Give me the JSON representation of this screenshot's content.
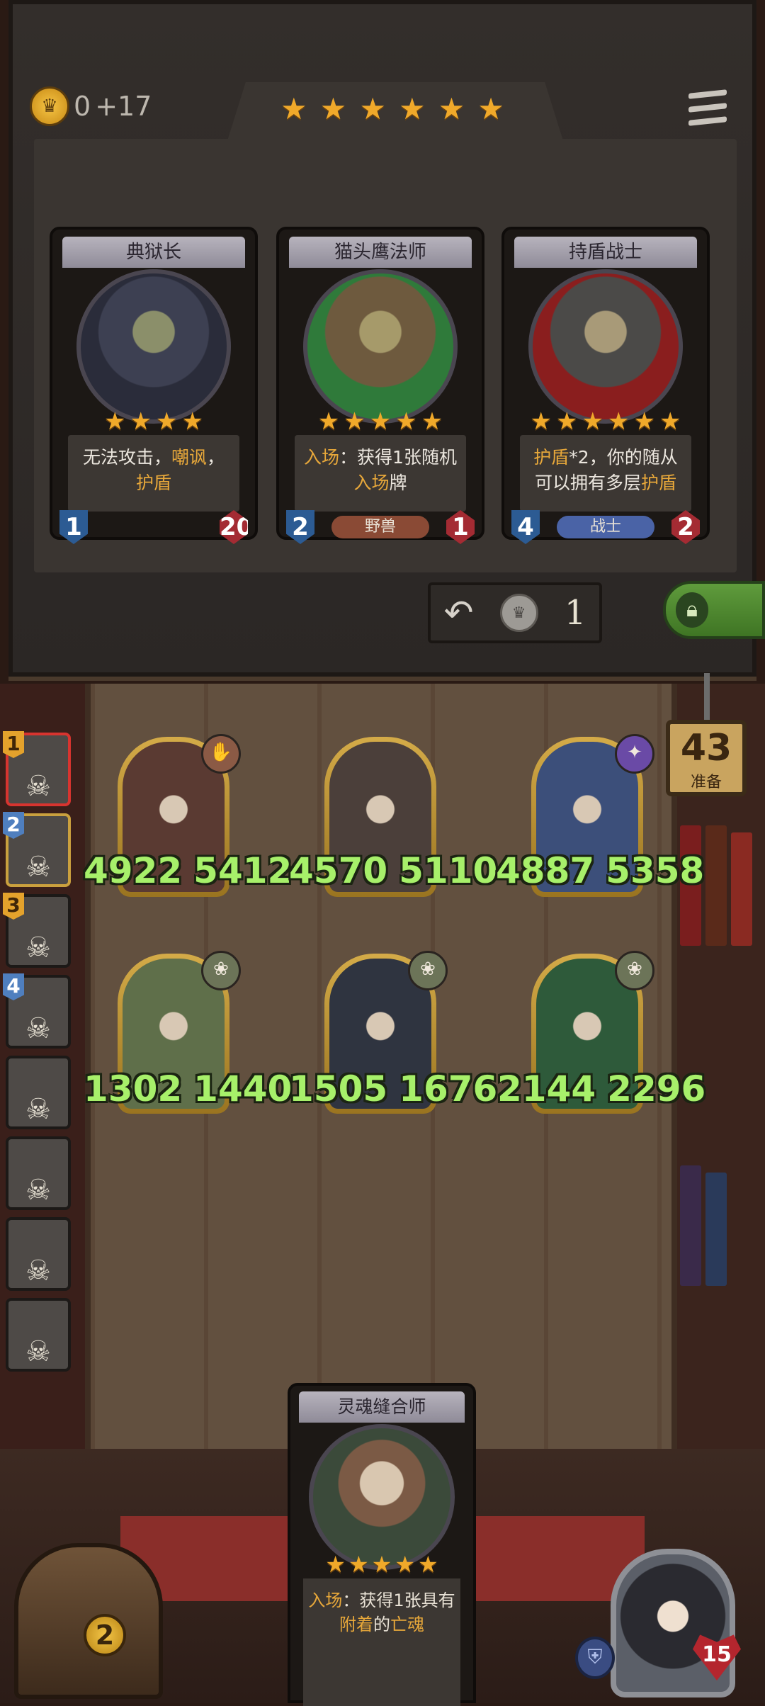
{
  "gold": {
    "amount": "0",
    "income": "+17",
    "icon": "crown-coin-icon"
  },
  "tavern_stars": 6,
  "shop": {
    "cards": [
      {
        "name": "典狱长",
        "stars": 4,
        "desc_parts": [
          {
            "text": "无法攻击，",
            "hl": false
          },
          {
            "text": "嘲讽",
            "hl": true
          },
          {
            "text": "，",
            "hl": false
          },
          {
            "text": "\n",
            "hl": false
          },
          {
            "text": "护盾",
            "hl": true
          }
        ],
        "attack": "1",
        "health": "20",
        "tribe": "",
        "art_colors": [
          "#3d4052",
          "#2a2c3a",
          "#8b8f6a"
        ]
      },
      {
        "name": "猫头鹰法师",
        "stars": 5,
        "desc_parts": [
          {
            "text": "入场",
            "hl": true
          },
          {
            "text": "：获得1张随机",
            "hl": false
          },
          {
            "text": "\n",
            "hl": false
          },
          {
            "text": "入场",
            "hl": true
          },
          {
            "text": "牌",
            "hl": false
          }
        ],
        "attack": "2",
        "health": "1",
        "tribe": "野兽",
        "tribe_color": "#8a4a35",
        "art_colors": [
          "#6e5a3e",
          "#2f7a3a",
          "#a69a6a"
        ]
      },
      {
        "name": "持盾战士",
        "stars": 6,
        "desc_parts": [
          {
            "text": "护盾",
            "hl": true
          },
          {
            "text": "*2，你的随从",
            "hl": false
          },
          {
            "text": "\n",
            "hl": false
          },
          {
            "text": "可以拥有多层",
            "hl": false
          },
          {
            "text": "护盾",
            "hl": true
          }
        ],
        "attack": "4",
        "health": "2",
        "tribe": "战士",
        "tribe_color": "#4a63a6",
        "art_colors": [
          "#4b4a48",
          "#8a1e1e",
          "#a89a78"
        ]
      }
    ],
    "refresh_cost": "1",
    "refresh_icon": "refresh-icon",
    "lock_icon": "lock-icon"
  },
  "turn": {
    "number": "43",
    "label": "准备"
  },
  "opponents": [
    {
      "rank": "1",
      "rank_color": "gold",
      "current": true
    },
    {
      "rank": "2",
      "rank_color": "blue",
      "current": false
    },
    {
      "rank": "3",
      "rank_color": "gold",
      "current": false
    },
    {
      "rank": "4",
      "rank_color": "blue",
      "current": false
    },
    {
      "rank": "",
      "rank_color": "",
      "current": false
    },
    {
      "rank": "",
      "rank_color": "",
      "current": false
    },
    {
      "rank": "",
      "rank_color": "",
      "current": false
    },
    {
      "rank": "",
      "rank_color": "",
      "current": false
    }
  ],
  "board": [
    {
      "attack": "4922",
      "health": "5412",
      "tribe_icon": "claw-icon",
      "tribe_color": "#8b5a45",
      "art": "#5a3a32"
    },
    {
      "attack": "4570",
      "health": "5110",
      "tribe_icon": "",
      "tribe_color": "",
      "art": "#4b3f3a"
    },
    {
      "attack": "4887",
      "health": "5358",
      "tribe_icon": "arcane-icon",
      "tribe_color": "#6a4aa6",
      "art": "#3c4f7a"
    },
    {
      "attack": "1302",
      "health": "1440",
      "tribe_icon": "paw-icon",
      "tribe_color": "#6c7458",
      "art": "#5f6f4a"
    },
    {
      "attack": "1505",
      "health": "1676",
      "tribe_icon": "paw-icon",
      "tribe_color": "#6c7458",
      "art": "#2f3440"
    },
    {
      "attack": "2144",
      "health": "2296",
      "tribe_icon": "paw-icon",
      "tribe_color": "#6c7458",
      "art": "#2e5a3a"
    }
  ],
  "hand": {
    "name": "灵魂缝合师",
    "stars": 5,
    "desc_parts": [
      {
        "text": "入场",
        "hl": true
      },
      {
        "text": "：获得1张具有",
        "hl": false
      },
      {
        "text": "\n",
        "hl": false
      },
      {
        "text": "附着",
        "hl": true
      },
      {
        "text": "的",
        "hl": false
      },
      {
        "text": "亡魂",
        "hl": true
      }
    ]
  },
  "chest_count": "2",
  "hero": {
    "health": "15",
    "shield_icon": "shield-icon"
  }
}
